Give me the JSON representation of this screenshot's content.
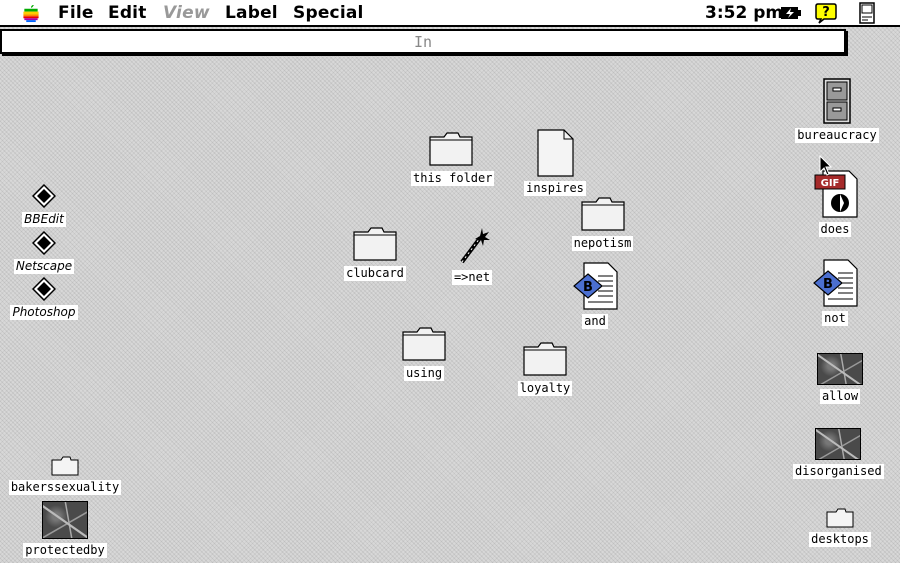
{
  "menubar": {
    "menus": [
      "File",
      "Edit",
      "View",
      "Label",
      "Special"
    ],
    "clock": "3:52 pm"
  },
  "window": {
    "title": "In"
  },
  "icons": {
    "this_folder": "this folder",
    "inspires": "inspires",
    "nepotism": "nepotism",
    "clubcard": "clubcard",
    "net": "=>net",
    "and": "and",
    "using": "using",
    "loyalty": "loyalty",
    "bbedit": "BBEdit",
    "netscape": "Netscape",
    "photoshop": "Photoshop",
    "bakers": "bakerssexuality",
    "protectedby": "protectedby",
    "bureaucracy": "bureaucracy",
    "does": "does",
    "not": "not",
    "allow": "allow",
    "disorganised": "disorganised",
    "desktops": "desktops",
    "gif_badge": "GIF"
  }
}
